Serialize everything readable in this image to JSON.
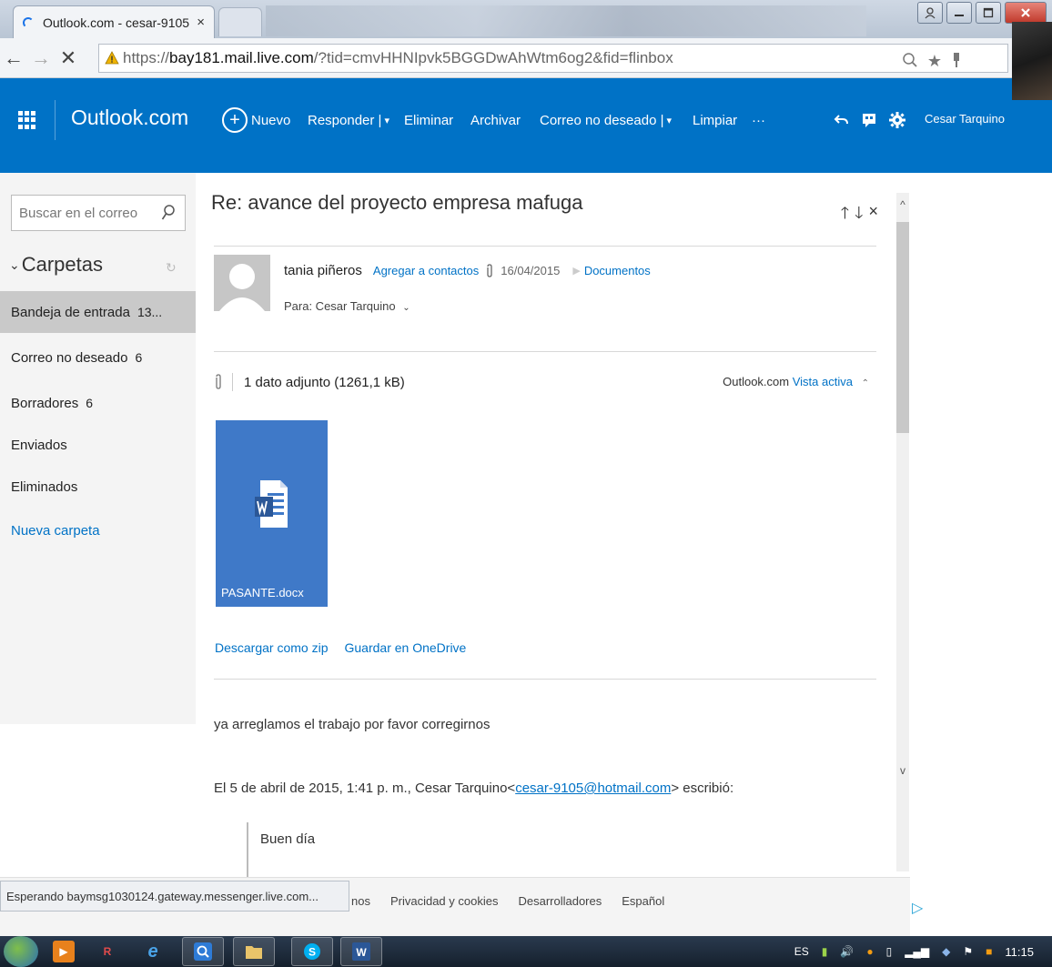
{
  "browser": {
    "tab_title": "Outlook.com - cesar-9105",
    "tab_close": "×",
    "url_prefix": "https://",
    "url_host": "bay181.mail.live.com",
    "url_path": "/?tid=cmvHHNIpvk5BGGDwAhWtm6og2&fid=flinbox",
    "menu_icon": "≡",
    "status_text": "Esperando baymsg1030124.gateway.messenger.live.com..."
  },
  "outlook": {
    "brand": "Outlook.com",
    "commands": {
      "new": "Nuevo",
      "reply": "Responder |",
      "delete": "Eliminar",
      "archive": "Archivar",
      "junk": "Correo no deseado |",
      "sweep": "Limpiar",
      "more": "···"
    },
    "user_name": "Cesar Tarquino"
  },
  "sidebar": {
    "search_placeholder": "Buscar en el correo",
    "folders_title": "Carpetas",
    "folders": [
      {
        "label": "Bandeja de entrada",
        "count": "13..."
      },
      {
        "label": "Correo no deseado",
        "count": "6"
      },
      {
        "label": "Borradores",
        "count": "6"
      },
      {
        "label": "Enviados",
        "count": ""
      },
      {
        "label": "Eliminados",
        "count": ""
      }
    ],
    "new_folder": "Nueva carpeta"
  },
  "message": {
    "subject": "Re: avance del proyecto empresa mafuga",
    "sender": "tania piñeros",
    "add_contact": "Agregar a contactos",
    "date": "16/04/2015",
    "category": "Documentos",
    "to_line": "Para: Cesar Tarquino",
    "attachment_summary": "1 dato adjunto (1261,1 kB)",
    "attachment_view_prefix": "Outlook.com",
    "attachment_view_link": "Vista activa",
    "attachment_file": "PASANTE.docx",
    "download_zip": "Descargar como zip",
    "save_onedrive": "Guardar en OneDrive",
    "body_line1": "ya arreglamos el trabajo por favor corregirnos",
    "quote_intro_prefix": "El 5 de abril de 2015, 1:41 p. m., Cesar Tarquino<",
    "quote_intro_email": "cesar-9105@hotmail.com",
    "quote_intro_suffix": "> escribió:",
    "quote_text": "Buen día"
  },
  "footer": {
    "links": [
      "nos",
      "Privacidad y cookies",
      "Desarrolladores",
      "Español"
    ]
  },
  "taskbar": {
    "lang": "ES",
    "clock": "11:15"
  },
  "colors": {
    "outlook_blue": "#0072c6",
    "link_blue": "#0072c6",
    "doc_tile": "#3f79c8"
  }
}
